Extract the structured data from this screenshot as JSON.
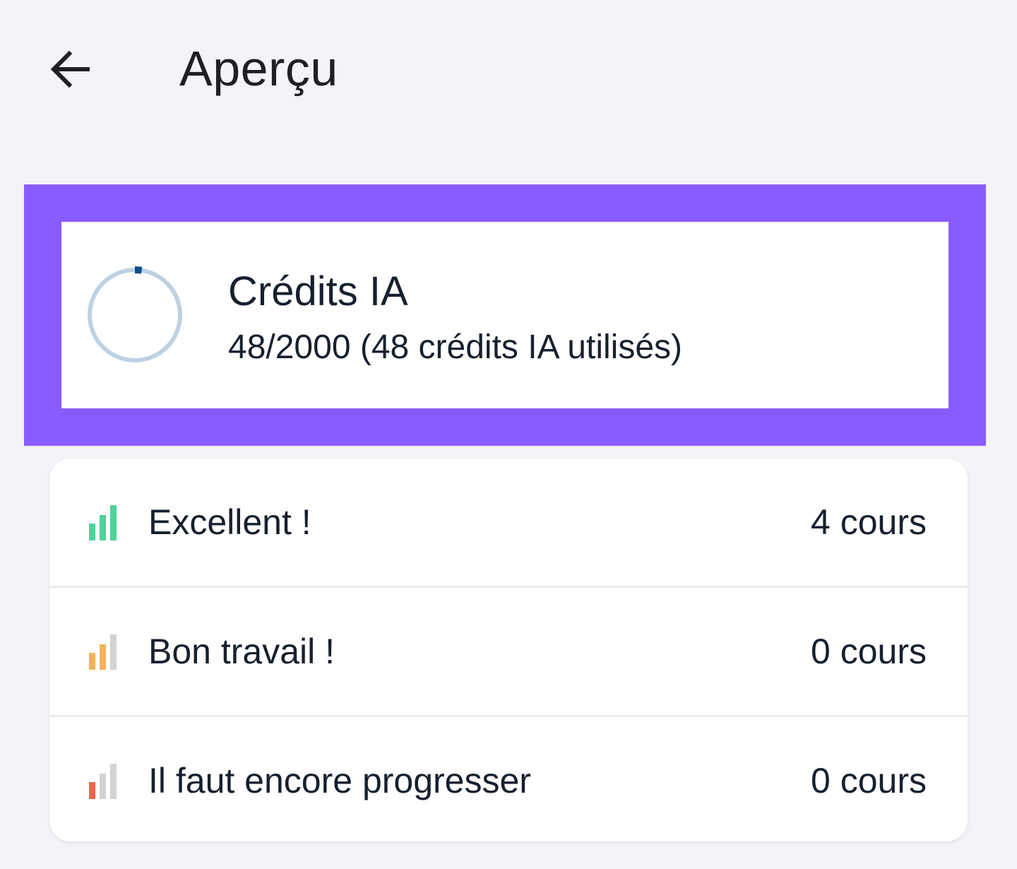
{
  "header": {
    "title": "Aperçu",
    "back_icon": "arrow-left-icon"
  },
  "credits": {
    "title": "Crédits IA",
    "detail": "48/2000 (48 crédits IA utilisés)",
    "used": 48,
    "total": 2000,
    "ring_track_color": "#bed1e3",
    "ring_fill_color": "#0b4e8a"
  },
  "highlight": {
    "color": "#8a5cff"
  },
  "stats": [
    {
      "label": "Excellent !",
      "value": "4 cours",
      "icon": "signal-bars-high-icon",
      "active_bars": 3,
      "color": "#4dd39a"
    },
    {
      "label": "Bon travail !",
      "value": "0 cours",
      "icon": "signal-bars-medium-icon",
      "active_bars": 2,
      "color": "#f4b25f"
    },
    {
      "label": "Il faut encore progresser",
      "value": "0 cours",
      "icon": "signal-bars-low-icon",
      "active_bars": 1,
      "color": "#e8664a"
    }
  ]
}
